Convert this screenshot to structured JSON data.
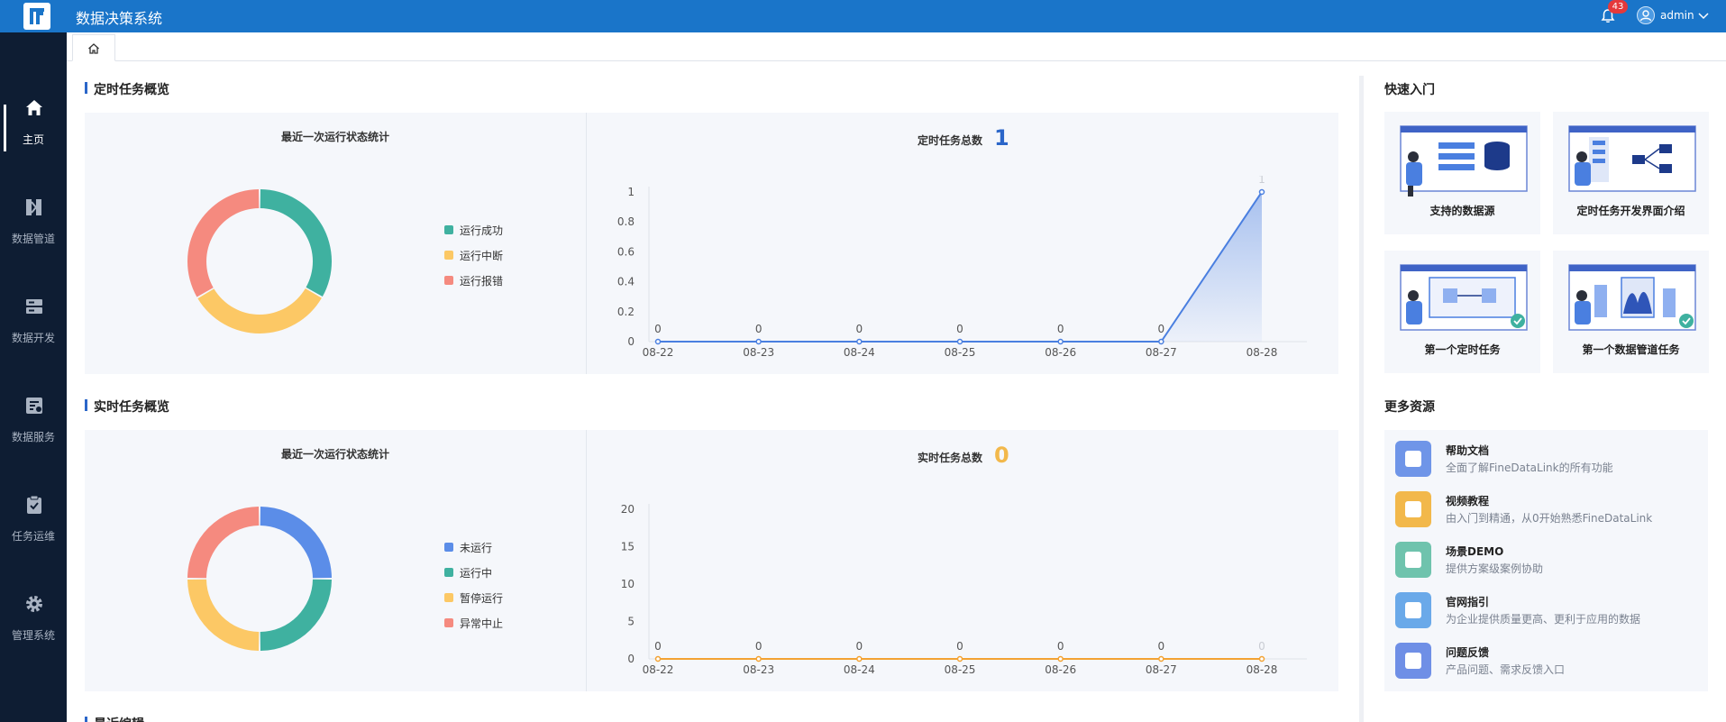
{
  "header": {
    "app_title": "数据决策系统",
    "notification_count": "43",
    "username": "admin"
  },
  "sidebar": {
    "items": [
      {
        "label": "主页",
        "icon": "home-icon",
        "active": true
      },
      {
        "label": "数据管道",
        "icon": "pipeline-icon",
        "active": false
      },
      {
        "label": "数据开发",
        "icon": "database-icon",
        "active": false
      },
      {
        "label": "数据服务",
        "icon": "service-icon",
        "active": false
      },
      {
        "label": "任务运维",
        "icon": "clipboard-check-icon",
        "active": false
      },
      {
        "label": "管理系统",
        "icon": "gear-icon",
        "active": false
      }
    ]
  },
  "tabs": [
    {
      "icon": "home-icon"
    }
  ],
  "scheduled": {
    "section_title": "定时任务概览",
    "stat_title": "最近一次运行状态统计",
    "total_label": "定时任务总数",
    "total_value": "1",
    "legend": [
      "运行成功",
      "运行中断",
      "运行报错"
    ]
  },
  "realtime": {
    "section_title": "实时任务概览",
    "stat_title": "最近一次运行状态统计",
    "total_label": "实时任务总数",
    "total_value": "0",
    "legend": [
      "未运行",
      "运行中",
      "暂停运行",
      "异常中止"
    ]
  },
  "recent_section_title": "最近编辑",
  "quick_start": {
    "title": "快速入门",
    "cards": [
      "支持的数据源",
      "定时任务开发界面介绍",
      "第一个定时任务",
      "第一个数据管道任务"
    ]
  },
  "more_resources": {
    "title": "更多资源",
    "items": [
      {
        "title": "帮助文档",
        "desc": "全面了解FineDataLink的所有功能",
        "color": "#6f95e8"
      },
      {
        "title": "视频教程",
        "desc": "由入门到精通，从0开始熟悉FineDataLink",
        "color": "#f2b84b"
      },
      {
        "title": "场景DEMO",
        "desc": "提供方案级案例协助",
        "color": "#6fc3ad"
      },
      {
        "title": "官网指引",
        "desc": "为企业提供质量更高、更利于应用的数据",
        "color": "#6aa9e9"
      },
      {
        "title": "问题反馈",
        "desc": "产品问题、需求反馈入口",
        "color": "#6f8fe6"
      }
    ]
  },
  "chart_data": [
    {
      "type": "pie",
      "title": "最近一次运行状态统计",
      "categories": [
        "运行成功",
        "运行中断",
        "运行报错"
      ],
      "values": [
        33.3,
        33.3,
        33.4
      ],
      "colors": [
        "#3fb1a0",
        "#fcc865",
        "#f58a7f"
      ],
      "start_angle_deg": 0
    },
    {
      "type": "area",
      "title": "定时任务总数",
      "categories": [
        "08-22",
        "08-23",
        "08-24",
        "08-25",
        "08-26",
        "08-27",
        "08-28"
      ],
      "values": [
        0,
        0,
        0,
        0,
        0,
        0,
        1
      ],
      "data_labels": [
        "0",
        "0",
        "0",
        "0",
        "0",
        "0",
        "1"
      ],
      "ylim": [
        0,
        1
      ],
      "yticks": [
        "0",
        "0.2",
        "0.4",
        "0.6",
        "0.8",
        "1"
      ],
      "color": "#4a7fe0",
      "grid": false
    },
    {
      "type": "pie",
      "title": "最近一次运行状态统计",
      "categories": [
        "未运行",
        "运行中",
        "暂停运行",
        "异常中止"
      ],
      "values": [
        25,
        25,
        25,
        25
      ],
      "colors": [
        "#5b8de8",
        "#3fb1a0",
        "#fcc865",
        "#f58a7f"
      ],
      "start_angle_deg": 0
    },
    {
      "type": "line",
      "title": "实时任务总数",
      "categories": [
        "08-22",
        "08-23",
        "08-24",
        "08-25",
        "08-26",
        "08-27",
        "08-28"
      ],
      "values": [
        0,
        0,
        0,
        0,
        0,
        0,
        0
      ],
      "data_labels": [
        "0",
        "0",
        "0",
        "0",
        "0",
        "0",
        "0"
      ],
      "ylim": [
        0,
        20
      ],
      "yticks": [
        "0",
        "5",
        "10",
        "15",
        "20"
      ],
      "color": "#f3a232",
      "grid": false
    }
  ]
}
